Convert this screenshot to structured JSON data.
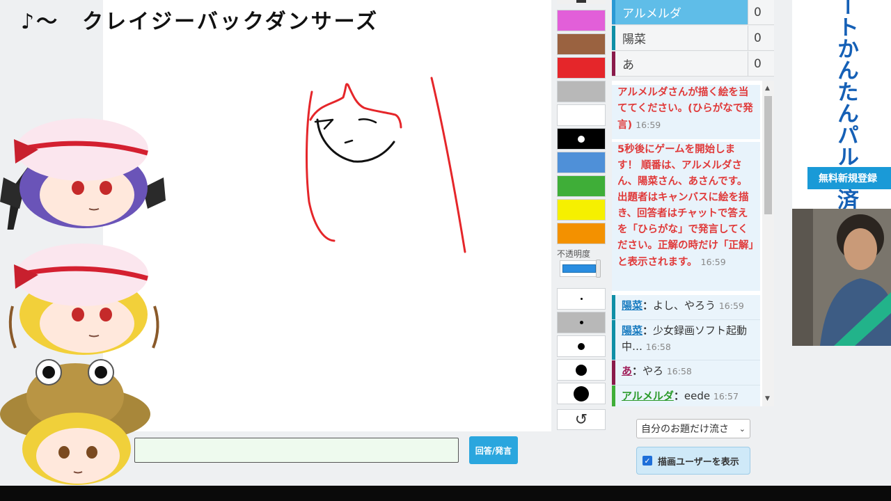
{
  "song_title": "♪～　クレイジーバックダンサーズ",
  "answer": {
    "value": "",
    "button_label": "回答/発言"
  },
  "palette": {
    "colors": [
      "#e25fd9",
      "#9a6240",
      "#e5262a",
      "#b8b8b8",
      "#ffffff",
      "#000000",
      "#4f90d8",
      "#3fae38",
      "#f6f000",
      "#f39100"
    ],
    "opacity_label": "不透明度",
    "opacity_value": 0.85,
    "brush_sizes": [
      "xs",
      "s",
      "m",
      "l",
      "xl"
    ],
    "undo_icon": "undo-icon"
  },
  "players": [
    {
      "name": "アルメルダ",
      "score": "0",
      "color": "#2a9ad5"
    },
    {
      "name": "陽菜",
      "score": "0",
      "color": "#0f8fa6"
    },
    {
      "name": "あ",
      "score": "0",
      "color": "#8a1a4a"
    }
  ],
  "chat": {
    "system_messages": [
      {
        "text": "アルメルダさんが描く絵を当ててください。(ひらがなで発言)",
        "time": "16:59"
      },
      {
        "text": "5秒後にゲームを開始します！ 順番は、アルメルダさん、陽菜さん、あさんです。出題者はキャンバスに絵を描き、回答者はチャットで答えを「ひらがな」で発言してください。正解の時だけ「正解」と表示されます。",
        "time": "16:59"
      }
    ],
    "messages": [
      {
        "user": "陽菜",
        "text": "よし、やろう",
        "time": "16:59",
        "user_color": "#1a7cc0",
        "bar_color": "#0f8fa6"
      },
      {
        "user": "陽菜",
        "text": "少女録画ソフト起動中…",
        "time": "16:58",
        "user_color": "#1a7cc0",
        "bar_color": "#0f8fa6"
      },
      {
        "user": "あ",
        "text": "やろ",
        "time": "16:58",
        "user_color": "#a0205a",
        "bar_color": "#8a1a4a"
      },
      {
        "user": "アルメルダ",
        "text": "eede",
        "time": "16:57",
        "user_color": "#2a9a2a",
        "bar_color": "#3fae38"
      }
    ]
  },
  "controls": {
    "topic_select": "自分のお題だけ流さ",
    "show_draw_user": "描画ユーザーを表示",
    "show_draw_user_checked": true
  },
  "ad": {
    "headline": "ートかんたんパル決済",
    "cta": "無料新規登録"
  }
}
